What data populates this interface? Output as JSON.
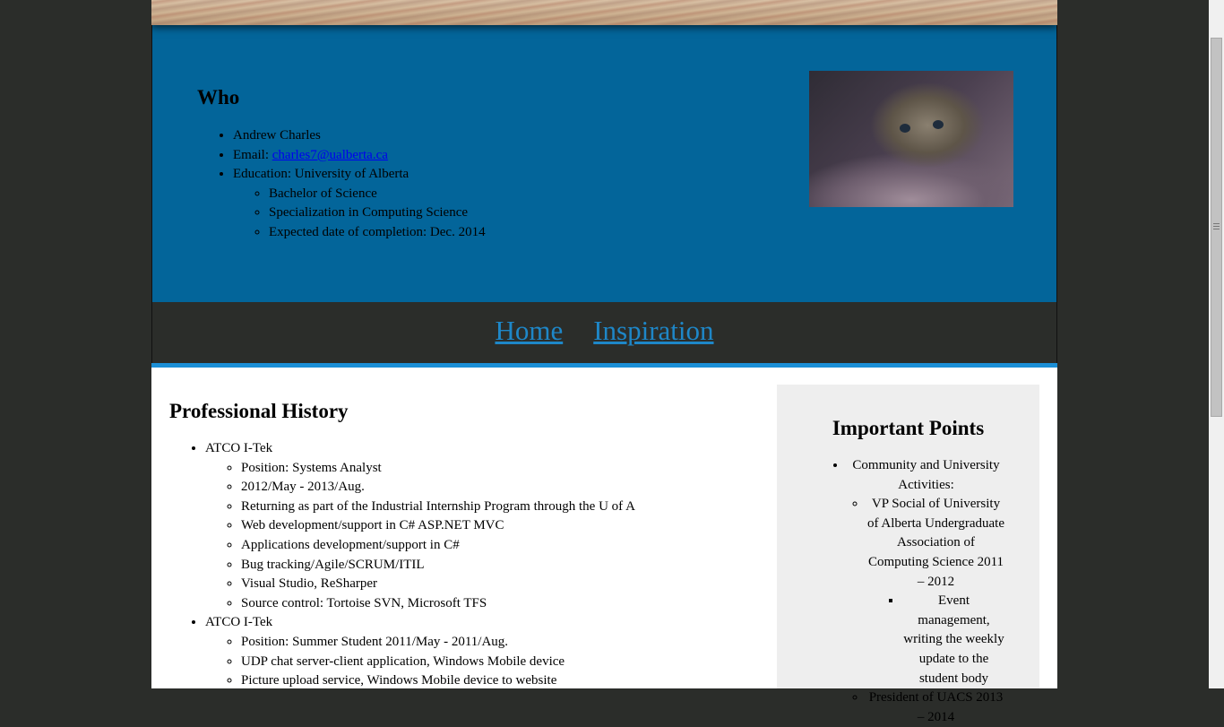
{
  "who": {
    "title": "Who",
    "name": "Andrew Charles",
    "email_label": "Email: ",
    "email": "charles7@ualberta.ca",
    "education": "Education: University of Alberta",
    "education_items": [
      "Bachelor of Science",
      "Specialization in Computing Science",
      "Expected date of completion: Dec. 2014"
    ]
  },
  "nav": {
    "home": "Home",
    "inspiration": "Inspiration"
  },
  "professional_history": {
    "title": "Professional History",
    "jobs": [
      {
        "company": "ATCO I-Tek",
        "details": [
          "Position: Systems Analyst",
          "2012/May - 2013/Aug.",
          "Returning as part of the Industrial Internship Program through the U of A",
          "Web development/support in C# ASP.NET MVC",
          "Applications development/support in C#",
          "Bug tracking/Agile/SCRUM/ITIL",
          "Visual Studio, ReSharper",
          "Source control: Tortoise SVN, Microsoft TFS"
        ]
      },
      {
        "company": "ATCO I-Tek",
        "details": [
          "Position: Summer Student 2011/May - 2011/Aug.",
          "UDP chat server-client application, Windows Mobile device",
          "Picture upload service, Windows Mobile device to website"
        ]
      }
    ]
  },
  "important_points": {
    "title": "Important Points",
    "item": "Community and University Activities:",
    "sub1": "VP Social of University of Alberta Undergraduate Association of Computing Science 2011 – 2012",
    "sub1_detail": "Event management, writing the weekly update to the student body",
    "sub2": "President of UACS 2013 – 2014"
  },
  "colors": {
    "who_bg": "#03659a",
    "nav_bg": "#2b2d2a",
    "nav_link": "#1e87c8",
    "accent_line": "#1b8fd6",
    "sidebar_bg": "#eeeeee"
  }
}
